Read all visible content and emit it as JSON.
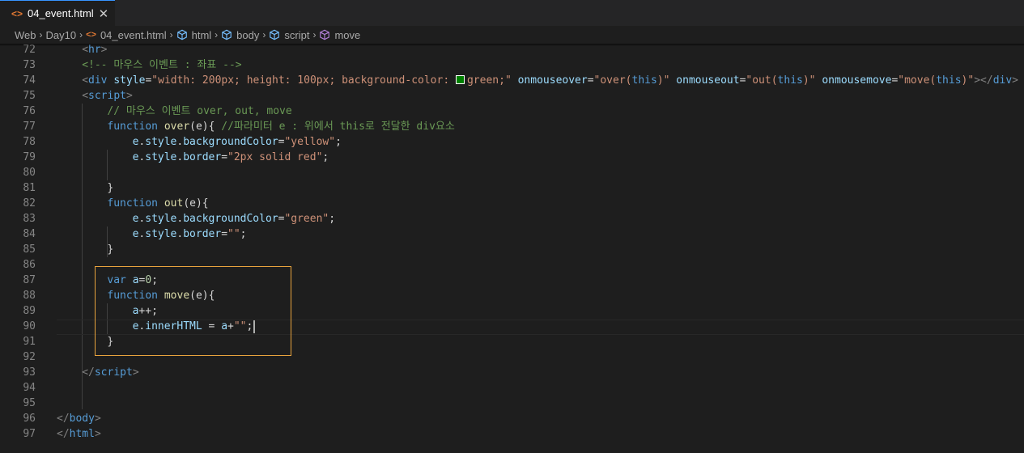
{
  "tab": {
    "icon": "html-file-icon",
    "label": "04_event.html",
    "close": "✕"
  },
  "breadcrumb": [
    "Web",
    "Day10",
    "04_event.html",
    "html",
    "body",
    "script",
    "move"
  ],
  "colors": {
    "tab_active_border": "#3794ff",
    "highlight_box": "#e8a33d",
    "html_icon": "#e37933",
    "swatch_green": "#008000"
  },
  "code_lines": [
    {
      "n": "72",
      "tokens": [
        [
          "gray",
          "<"
        ],
        [
          "tag",
          "hr"
        ],
        [
          "gray",
          ">"
        ]
      ]
    },
    {
      "n": "73",
      "tokens": [
        [
          "cm",
          "<!-- 마우스 이벤트 : 좌표 -->"
        ]
      ]
    },
    {
      "n": "74",
      "tokens": [
        [
          "gray",
          "<"
        ],
        [
          "tag",
          "div"
        ],
        [
          "txt",
          " "
        ],
        [
          "attr",
          "style"
        ],
        [
          "txt",
          "="
        ],
        [
          "str",
          "\"width: 200px; height: 100px; background-color: "
        ],
        [
          "swatch",
          ""
        ],
        [
          "str",
          "green;\""
        ],
        [
          "txt",
          " "
        ],
        [
          "attr",
          "onmouseover"
        ],
        [
          "txt",
          "="
        ],
        [
          "str",
          "\"over("
        ],
        [
          "tag",
          "this"
        ],
        [
          "str",
          ")\""
        ],
        [
          "txt",
          " "
        ],
        [
          "attr",
          "onmouseout"
        ],
        [
          "txt",
          "="
        ],
        [
          "str",
          "\"out("
        ],
        [
          "tag",
          "this"
        ],
        [
          "str",
          ")\""
        ],
        [
          "txt",
          " "
        ],
        [
          "attr",
          "onmousemove"
        ],
        [
          "txt",
          "="
        ],
        [
          "str",
          "\"move("
        ],
        [
          "tag",
          "this"
        ],
        [
          "str",
          ")\""
        ],
        [
          "gray",
          "></"
        ],
        [
          "tag",
          "div"
        ],
        [
          "gray",
          ">"
        ]
      ]
    },
    {
      "n": "75",
      "tokens": [
        [
          "gray",
          "<"
        ],
        [
          "tag",
          "script"
        ],
        [
          "gray",
          ">"
        ]
      ]
    },
    {
      "n": "76",
      "tokens": [
        [
          "cm",
          "// 마우스 이벤트 over, out, move"
        ]
      ]
    },
    {
      "n": "77",
      "tokens": [
        [
          "kw",
          "function"
        ],
        [
          "txt",
          " "
        ],
        [
          "fn",
          "over"
        ],
        [
          "txt",
          "(e){ "
        ],
        [
          "cm",
          "//파라미터 e : 위에서 this로 전달한 div요소"
        ]
      ]
    },
    {
      "n": "78",
      "tokens": [
        [
          "var",
          "e"
        ],
        [
          "txt",
          "."
        ],
        [
          "var",
          "style"
        ],
        [
          "txt",
          "."
        ],
        [
          "var",
          "backgroundColor"
        ],
        [
          "txt",
          "="
        ],
        [
          "str",
          "\"yellow\""
        ],
        [
          "txt",
          ";"
        ]
      ]
    },
    {
      "n": "79",
      "tokens": [
        [
          "var",
          "e"
        ],
        [
          "txt",
          "."
        ],
        [
          "var",
          "style"
        ],
        [
          "txt",
          "."
        ],
        [
          "var",
          "border"
        ],
        [
          "txt",
          "="
        ],
        [
          "str",
          "\"2px solid red\""
        ],
        [
          "txt",
          ";"
        ]
      ]
    },
    {
      "n": "80",
      "tokens": []
    },
    {
      "n": "81",
      "tokens": [
        [
          "txt",
          "}"
        ]
      ]
    },
    {
      "n": "82",
      "tokens": [
        [
          "kw",
          "function"
        ],
        [
          "txt",
          " "
        ],
        [
          "fn",
          "out"
        ],
        [
          "txt",
          "(e){"
        ]
      ]
    },
    {
      "n": "83",
      "tokens": [
        [
          "var",
          "e"
        ],
        [
          "txt",
          "."
        ],
        [
          "var",
          "style"
        ],
        [
          "txt",
          "."
        ],
        [
          "var",
          "backgroundColor"
        ],
        [
          "txt",
          "="
        ],
        [
          "str",
          "\"green\""
        ],
        [
          "txt",
          ";"
        ]
      ]
    },
    {
      "n": "84",
      "tokens": [
        [
          "var",
          "e"
        ],
        [
          "txt",
          "."
        ],
        [
          "var",
          "style"
        ],
        [
          "txt",
          "."
        ],
        [
          "var",
          "border"
        ],
        [
          "txt",
          "="
        ],
        [
          "str",
          "\"\""
        ],
        [
          "txt",
          ";"
        ]
      ]
    },
    {
      "n": "85",
      "tokens": [
        [
          "txt",
          "}"
        ]
      ]
    },
    {
      "n": "86",
      "tokens": []
    },
    {
      "n": "87",
      "tokens": [
        [
          "kw",
          "var"
        ],
        [
          "txt",
          " "
        ],
        [
          "var",
          "a"
        ],
        [
          "txt",
          "="
        ],
        [
          "num",
          "0"
        ],
        [
          "txt",
          ";"
        ]
      ]
    },
    {
      "n": "88",
      "tokens": [
        [
          "kw",
          "function"
        ],
        [
          "txt",
          " "
        ],
        [
          "fn",
          "move"
        ],
        [
          "txt",
          "(e){"
        ]
      ]
    },
    {
      "n": "89",
      "tokens": [
        [
          "var",
          "a"
        ],
        [
          "txt",
          "++;"
        ]
      ]
    },
    {
      "n": "90",
      "tokens": [
        [
          "var",
          "e"
        ],
        [
          "txt",
          "."
        ],
        [
          "var",
          "innerHTML"
        ],
        [
          "txt",
          " = "
        ],
        [
          "var",
          "a"
        ],
        [
          "txt",
          "+"
        ],
        [
          "str",
          "\"\""
        ],
        [
          "txt",
          ";"
        ],
        [
          "caret",
          ""
        ]
      ]
    },
    {
      "n": "91",
      "tokens": [
        [
          "txt",
          "}"
        ]
      ]
    },
    {
      "n": "92",
      "tokens": []
    },
    {
      "n": "93",
      "tokens": [
        [
          "gray",
          "</"
        ],
        [
          "tag",
          "script"
        ],
        [
          "gray",
          ">"
        ]
      ]
    },
    {
      "n": "94",
      "tokens": []
    },
    {
      "n": "95",
      "tokens": []
    },
    {
      "n": "96",
      "tokens": [
        [
          "gray",
          "</"
        ],
        [
          "tag",
          "body"
        ],
        [
          "gray",
          ">"
        ]
      ]
    },
    {
      "n": "97",
      "tokens": [
        [
          "gray",
          "</"
        ],
        [
          "tag",
          "html"
        ],
        [
          "gray",
          ">"
        ]
      ]
    }
  ]
}
